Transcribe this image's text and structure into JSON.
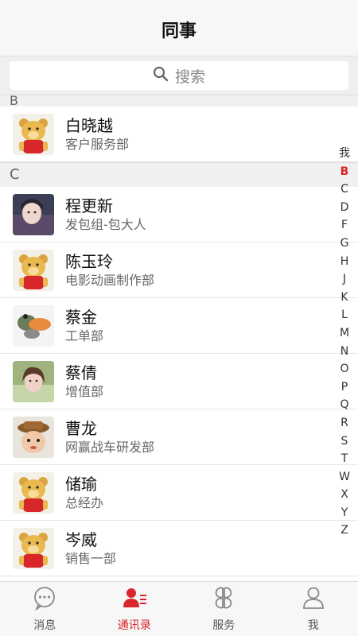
{
  "header": {
    "title": "同事"
  },
  "search": {
    "label": "搜索"
  },
  "sections": [
    {
      "letter": "B",
      "contacts": [
        {
          "name": "白晓越",
          "dept": "客户服务部",
          "avatar": "bear-avatar"
        }
      ]
    },
    {
      "letter": "C",
      "contacts": [
        {
          "name": "程更新",
          "dept": "发包组-包大人",
          "avatar": "photo-avatar"
        },
        {
          "name": "陈玉玲",
          "dept": "电影动画制作部",
          "avatar": "bear-avatar"
        },
        {
          "name": "蔡金",
          "dept": "工单部",
          "avatar": "duck-cartoon-avatar"
        },
        {
          "name": "蔡倩",
          "dept": "增值部",
          "avatar": "photo-avatar"
        },
        {
          "name": "曹龙",
          "dept": "网赢战车研发部",
          "avatar": "cartoon-face-avatar"
        },
        {
          "name": "储瑜",
          "dept": "总经办",
          "avatar": "bear-avatar"
        },
        {
          "name": "岑威",
          "dept": "销售一部",
          "avatar": "bear-avatar"
        }
      ]
    }
  ],
  "index_bar": {
    "letters": [
      "我",
      "B",
      "C",
      "D",
      "F",
      "G",
      "H",
      "J",
      "K",
      "L",
      "M",
      "N",
      "O",
      "P",
      "Q",
      "R",
      "S",
      "T",
      "W",
      "X",
      "Y",
      "Z"
    ],
    "active": "B",
    "active_color": "#d9262c"
  },
  "tabbar": {
    "tabs": [
      {
        "label": "消息",
        "icon": "chat-bubble-icon"
      },
      {
        "label": "通讯录",
        "icon": "contacts-icon"
      },
      {
        "label": "服务",
        "icon": "grid-clover-icon"
      },
      {
        "label": "我",
        "icon": "person-icon"
      }
    ],
    "active_index": 1
  }
}
